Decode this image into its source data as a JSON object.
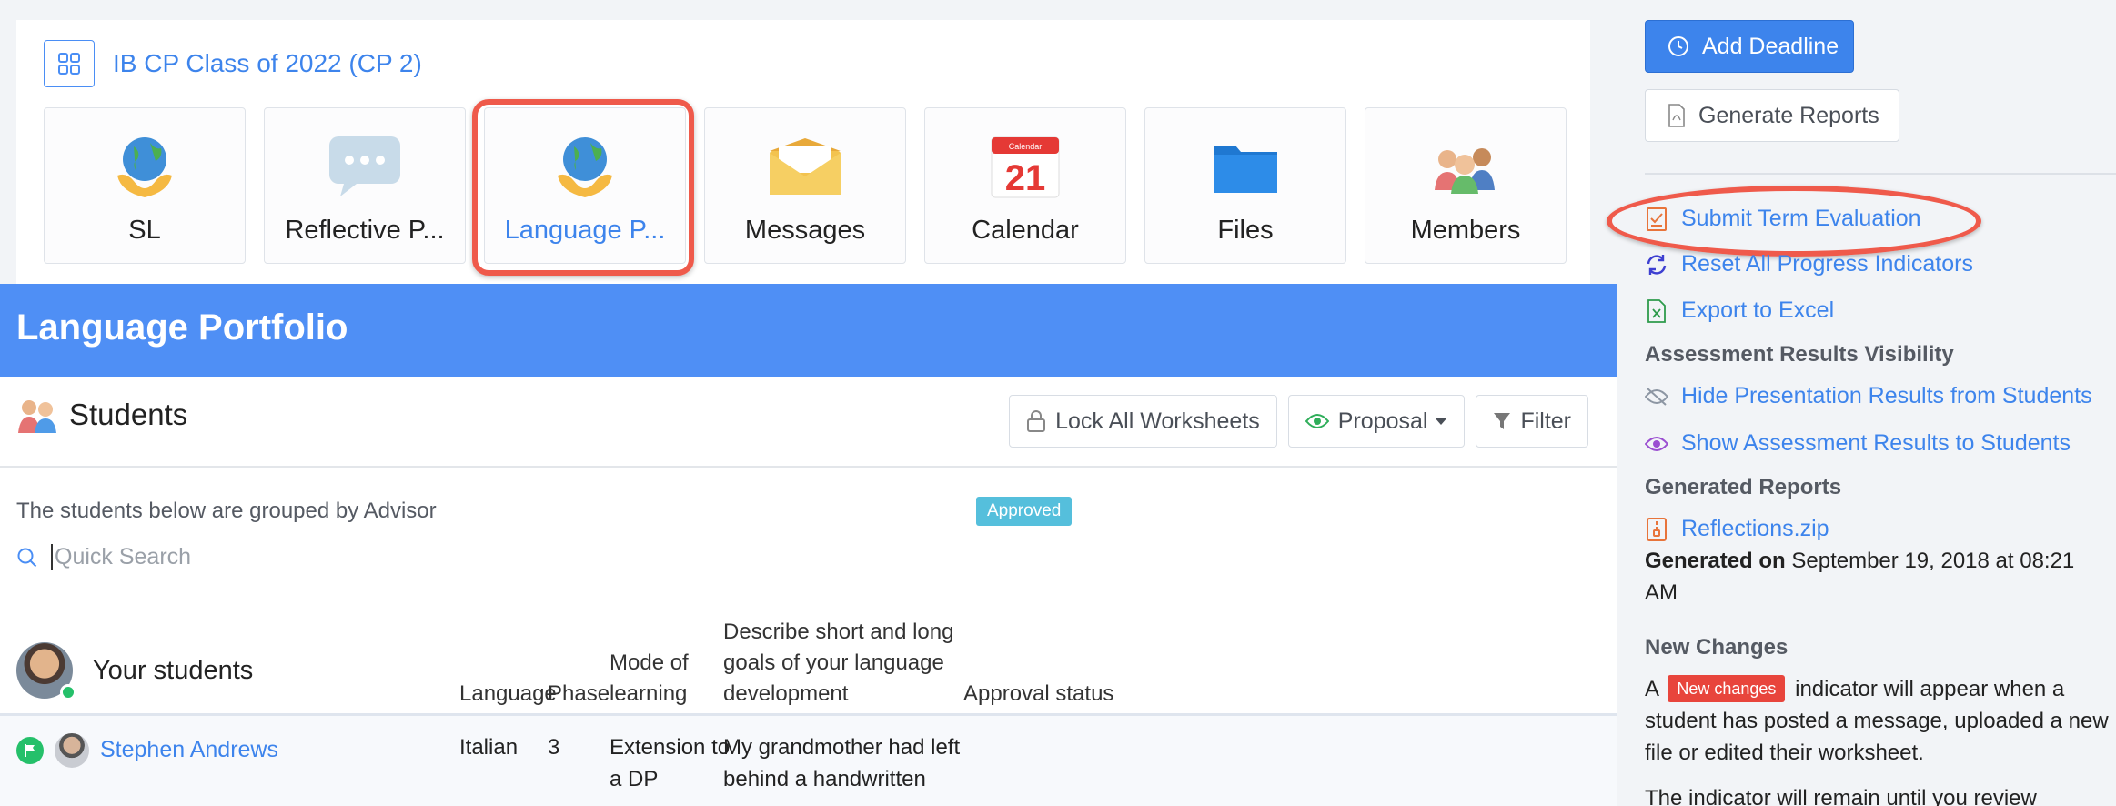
{
  "class": {
    "title": "IB CP Class of 2022 (CP 2)"
  },
  "tiles": [
    {
      "label": "SL",
      "icon": "globe-hands-icon"
    },
    {
      "label": "Reflective P...",
      "icon": "speech-bubble-icon"
    },
    {
      "label": "Language P...",
      "icon": "globe-hands-icon",
      "active": true
    },
    {
      "label": "Messages",
      "icon": "envelope-icon"
    },
    {
      "label": "Calendar",
      "icon": "calendar-icon",
      "calendar_header": "Calendar",
      "calendar_day": "21"
    },
    {
      "label": "Files",
      "icon": "folder-icon"
    },
    {
      "label": "Members",
      "icon": "people-icon"
    }
  ],
  "page": {
    "title": "Language Portfolio"
  },
  "students_panel": {
    "title": "Students",
    "toolbar": {
      "lock_label": "Lock All Worksheets",
      "proposal_label": "Proposal",
      "filter_label": "Filter"
    },
    "grouped_text": "The students below are grouped by Advisor",
    "search_placeholder": "Quick Search"
  },
  "table": {
    "group_label": "Your students",
    "headers": {
      "language": "Language",
      "phase": "Phase",
      "mode_1": "Mode of",
      "mode_2": "learning",
      "goals_1": "Describe short and long",
      "goals_2": "goals of your language",
      "goals_3": "development",
      "approval": "Approval status"
    },
    "rows": [
      {
        "name": "Stephen Andrews",
        "language": "Italian",
        "phase": "3",
        "mode_1": "Extension to",
        "mode_2": "a DP",
        "goals_1": "My grandmother had left",
        "goals_2": "behind a handwritten",
        "status": "Approved"
      }
    ]
  },
  "sidebar": {
    "add_deadline": "Add Deadline",
    "generate_reports": "Generate Reports",
    "links": {
      "submit_term": "Submit Term Evaluation",
      "reset_progress": "Reset All Progress Indicators",
      "export_excel": "Export to Excel"
    },
    "assessment_heading": "Assessment Results Visibility",
    "hide_presentation": "Hide Presentation Results from Students",
    "show_assessment": "Show Assessment Results to Students",
    "generated_heading": "Generated Reports",
    "report_file": "Reflections.zip",
    "generated_on_label": "Generated on",
    "generated_on_value": "September 19, 2018 at 08:21 AM",
    "new_changes_heading": "New Changes",
    "nc_text_a": "A",
    "nc_badge": "New changes",
    "nc_text_b": "indicator will appear when a student has posted a message, uploaded a new file or edited their worksheet.",
    "nc_text_c": "The indicator will remain until you review"
  },
  "colors": {
    "accent": "#3d84ec",
    "band": "#4f8ff5",
    "highlight": "#ef5a4b",
    "approved": "#55bfdc",
    "new_badge": "#e8453c"
  }
}
